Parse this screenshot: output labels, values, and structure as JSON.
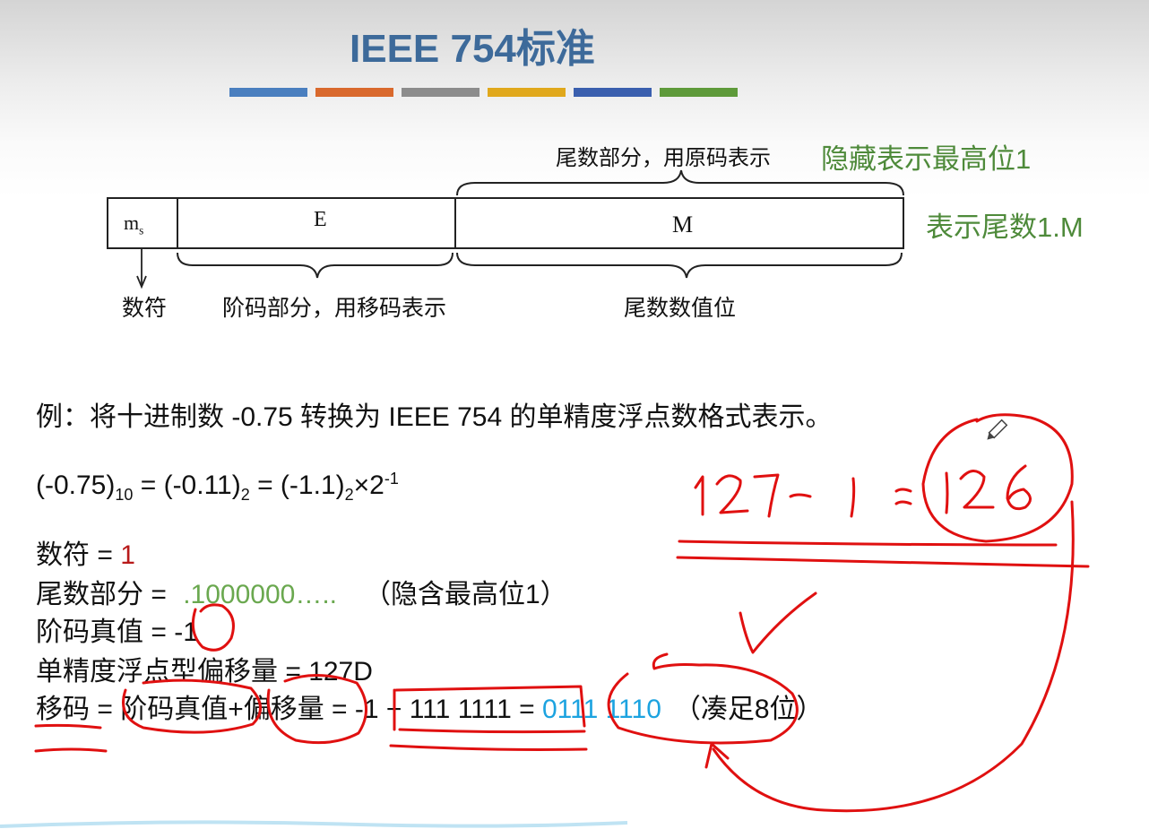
{
  "slide": {
    "title": "IEEE 754标准",
    "accent_bars": [
      "#4a7fbf",
      "#d9692d",
      "#8c8c8c",
      "#e0a81c",
      "#3a5fae",
      "#5e9a3a"
    ]
  },
  "diagram": {
    "cell_ms_main": "m",
    "cell_ms_sub": "s",
    "cell_e": "E",
    "cell_m": "M",
    "label_top_mantissa": "尾数部分，用原码表示",
    "label_sign": "数符",
    "label_exponent": "阶码部分，用移码表示",
    "label_mantissa_value": "尾数数值位",
    "note_hidden_bit": "隐藏表示最高位1",
    "note_represent": "表示尾数1.M"
  },
  "example": {
    "question": "例：将十进制数 -0.75 转换为 IEEE 754 的单精度浮点数格式表示。",
    "conv_a": "(-0.75)",
    "conv_a_sub": "10",
    "conv_b": " = (-0.11)",
    "conv_b_sub": "2",
    "conv_c": " = (-1.1)",
    "conv_c_sub": "2",
    "conv_d": "×2",
    "conv_d_sup": "-1",
    "sign_label": "数符 = ",
    "sign_value": "1",
    "mantissa_label": "尾数部分 = ",
    "mantissa_value": ".1000000…..",
    "mantissa_note": "（隐含最高位1）",
    "exp_label": "阶码真值 = ",
    "exp_value": "-1",
    "bias_line": "单精度浮点型偏移量 = 127D",
    "shift_label": "移码 = 阶码真值+偏移量 = ",
    "shift_expr": "-1 + 111 1111",
    "shift_eq": " = ",
    "shift_result": "0111 1110",
    "shift_note": "（凑足8位）"
  },
  "colors": {
    "ink_red": "#e01010",
    "value_red": "#b81a1a",
    "value_green": "#6aa84f",
    "value_blue": "#1ca3e0",
    "title_blue": "#3d6a9a",
    "note_green": "#4e8a3a"
  },
  "icons": [
    "pencil-icon",
    "checkmark-annotation"
  ]
}
